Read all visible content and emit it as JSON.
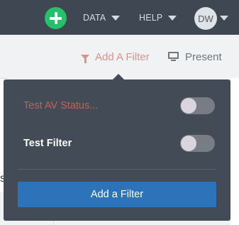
{
  "topbar": {
    "nav": [
      {
        "label": "DATA"
      },
      {
        "label": "HELP"
      }
    ],
    "avatar_initials": "DW"
  },
  "toolbar": {
    "add_filter_label": "Add A Filter",
    "present_label": "Present"
  },
  "left_panel": {
    "partial_glyph": "s"
  },
  "popover": {
    "filters": [
      {
        "label": "Test AV Status...",
        "enabled": false
      },
      {
        "label": "Test Filter",
        "enabled": false
      }
    ],
    "add_button_label": "Add a Filter"
  },
  "colors": {
    "topbar_bg": "#3f4753",
    "plus_green": "#25c168",
    "filter_link": "#e08f8a",
    "popover_bg": "#434b56",
    "primary_button": "#2c73ba",
    "muted_label": "#c4605c"
  },
  "icons": [
    "plus-icon",
    "caret-down-icon",
    "funnel-icon",
    "monitor-icon"
  ]
}
